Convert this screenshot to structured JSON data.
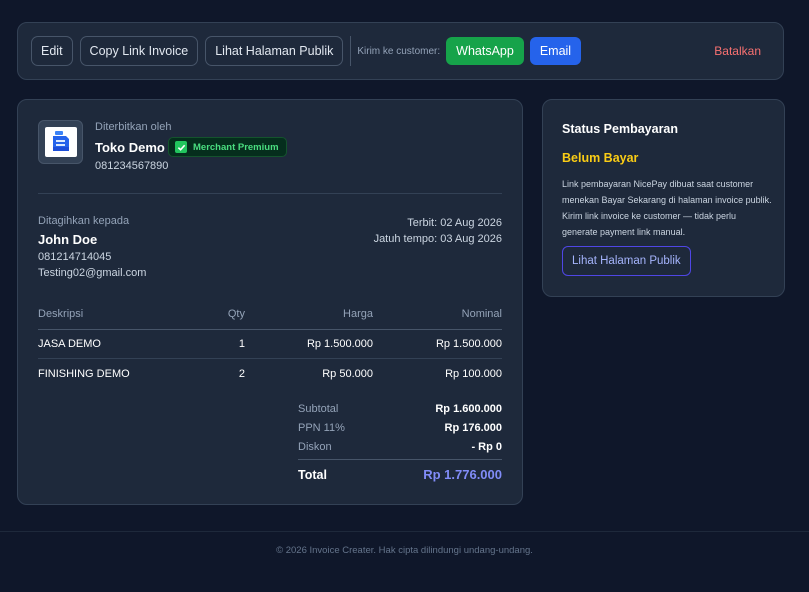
{
  "toolbar": {
    "edit_label": "Edit",
    "copy_link_label": "Copy Link Invoice",
    "public_page_label": "Lihat Halaman Publik",
    "send_to_label": "Kirim ke customer:",
    "whatsapp_label": "WhatsApp",
    "email_label": "Email",
    "cancel_label": "Batalkan"
  },
  "invoice": {
    "issued_by_label": "Diterbitkan oleh",
    "merchant_name": "Toko Demo",
    "merchant_badge": "Merchant Premium",
    "merchant_phone": "081234567890",
    "billed_to_label": "Ditagihkan kepada",
    "customer_name": "John Doe",
    "customer_phone": "081214714045",
    "customer_email": "Testing02@gmail.com",
    "issued_date": "Terbit: 02 Aug 2026",
    "due_date": "Jatuh tempo: 03 Aug 2026",
    "columns": [
      "Deskripsi",
      "Qty",
      "Harga",
      "Nominal"
    ],
    "items": [
      {
        "description": "JASA DEMO",
        "qty": "1",
        "price": "Rp 1.500.000",
        "amount": "Rp 1.500.000"
      },
      {
        "description": "FINISHING DEMO",
        "qty": "2",
        "price": "Rp 50.000",
        "amount": "Rp 100.000"
      }
    ],
    "summary": {
      "subtotal_label": "Subtotal",
      "subtotal_value": "Rp 1.600.000",
      "tax_label": "PPN 11%",
      "tax_value": "Rp 176.000",
      "discount_label": "Diskon",
      "discount_value": "- Rp 0",
      "total_label": "Total",
      "total_value": "Rp 1.776.000"
    }
  },
  "payment_status": {
    "title": "Status Pembayaran",
    "status": "Belum Bayar",
    "description": "Link pembayaran NicePay dibuat saat customer menekan Bayar Sekarang di halaman invoice publik. Kirim link invoice ke customer — tidak perlu generate payment link manual.",
    "button_label": "Lihat Halaman Publik"
  },
  "footer": {
    "text": "© 2026 Invoice Creater. Hak cipta dilindungi undang-undang."
  },
  "colors": {
    "background": "#0f172a",
    "card": "#1e293b",
    "whatsapp": "#16a34a",
    "email": "#2563eb",
    "cancel": "#f87171",
    "status_unpaid": "#facc15",
    "total_accent": "#818cf8",
    "badge": "#4ade80"
  },
  "icons": {
    "merchant_logo": "invoice-logo-icon",
    "badge_check": "check-icon"
  }
}
